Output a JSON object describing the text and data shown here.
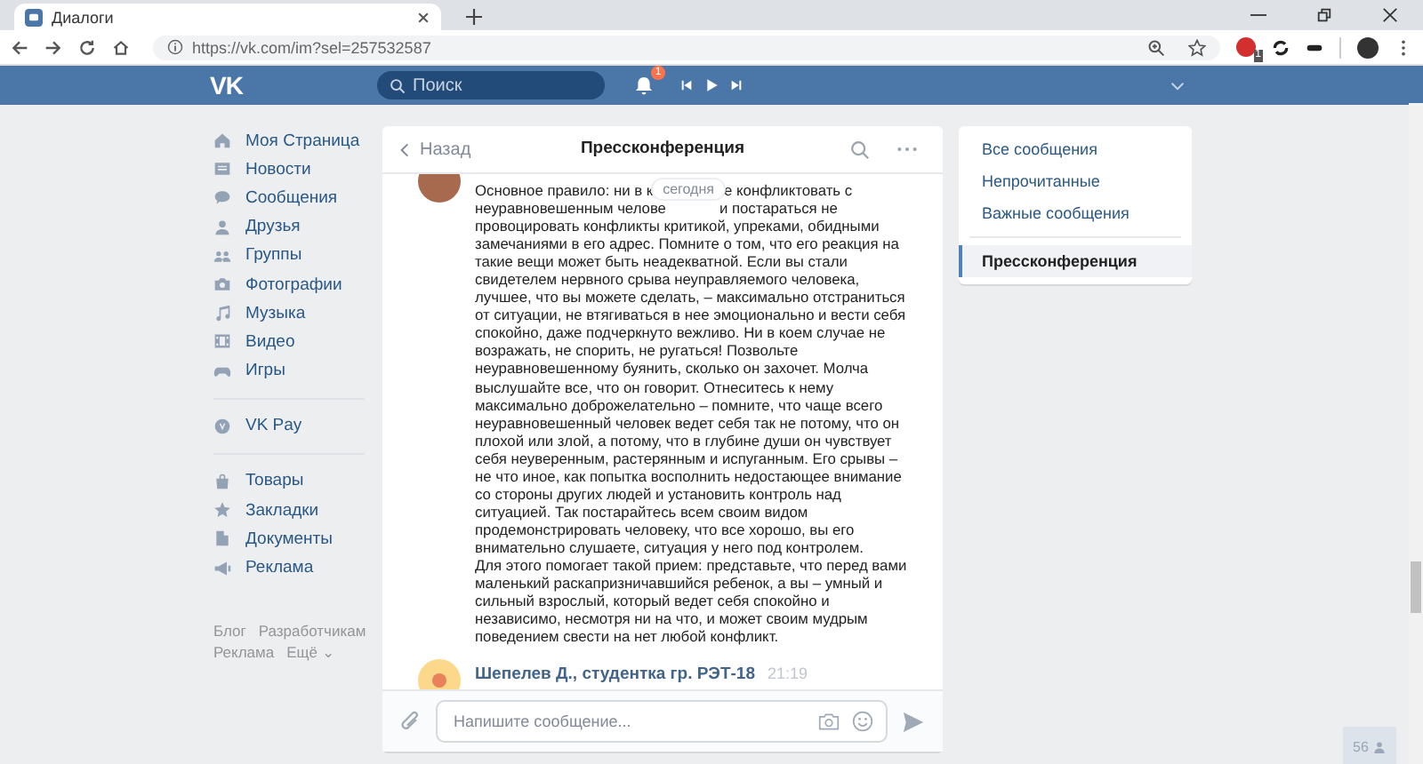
{
  "browser": {
    "tab": {
      "title": "Диалоги"
    },
    "url": "https://vk.com/im?sel=257532587",
    "extension_badge": "1"
  },
  "header": {
    "logo": "VK",
    "search": {
      "placeholder": "Поиск"
    },
    "notifications_badge": "1"
  },
  "sidebar": {
    "groups": [
      [
        {
          "label": "Моя Страница"
        },
        {
          "label": "Новости"
        },
        {
          "label": "Сообщения"
        },
        {
          "label": "Друзья"
        },
        {
          "label": "Группы"
        },
        {
          "label": "Фотографии"
        },
        {
          "label": "Музыка"
        },
        {
          "label": "Видео"
        },
        {
          "label": "Игры"
        }
      ],
      [
        {
          "label": "VK Pay"
        }
      ],
      [
        {
          "label": "Товары"
        },
        {
          "label": "Закладки"
        },
        {
          "label": "Документы"
        },
        {
          "label": "Реклама"
        }
      ]
    ],
    "footer_links": [
      "Блог",
      "Разработчикам",
      "Реклама",
      "Ещё ⌄"
    ]
  },
  "chat": {
    "back": "Назад",
    "title": "Прессконференция",
    "date_divider": "сегодня",
    "message": {
      "lines": [
        [
          "Основное правило: ни в к",
          "е конфликтовать с"
        ],
        [
          "неуравновешенным челове",
          "и постараться не"
        ],
        [
          "провоцировать конфликты критикой, упреками, обидными"
        ],
        [
          "замечаниями в его адрес. Помните о том, что его реакция на"
        ],
        [
          "такие вещи может быть неадекватной. Если вы стали"
        ],
        [
          "свидетелем нервного срыва неуправляемого человека,"
        ],
        [
          "лучшее, что вы можете сделать, – максимально отстраниться"
        ],
        [
          "от ситуации, не втягиваться в нее эмоционально и вести себя"
        ],
        [
          "спокойно, даже подчеркнуто вежливо. Ни в коем случае не"
        ],
        [
          "возражать, не спорить, не ругаться! Позвольте"
        ],
        [
          "неуравновешенному буянить, сколько он захочет. Молча"
        ],
        [
          "выслушайте все, что он говорит. Отнеситесь к нему"
        ],
        [
          "максимально доброжелательно – помните, что чаще всего"
        ],
        [
          "неуравновешенный человек ведет себя так не потому, что он"
        ],
        [
          "плохой или злой, а потому, что в глубине души он чувствует"
        ],
        [
          "себя неуверенным, растерянным и испуганным. Его срывы –"
        ],
        [
          "не что иное, как попытка восполнить недостающее внимание"
        ],
        [
          "со стороны других людей и установить контроль над"
        ],
        [
          "ситуацией. Так постарайтесь всем своим видом"
        ],
        [
          "продемонстрировать человеку, что все хорошо, вы его"
        ],
        [
          "внимательно слушаете, ситуация у него под контролем."
        ],
        [
          "Для этого помогает такой прием: представьте, что перед вами"
        ],
        [
          "маленький раскапризничавшийся ребенок, а вы – умный и"
        ],
        [
          "сильный взрослый, который ведет себя спокойно и"
        ],
        [
          "независимо, несмотря ни на что, и может своим мудрым"
        ],
        [
          "поведением свести на нет любой конфликт."
        ]
      ]
    },
    "next_message": {
      "author": "Шепелев Д., студентка гр. РЭТ-18",
      "time": "21:19"
    },
    "composer": {
      "placeholder": "Напишите сообщение..."
    }
  },
  "filters": [
    {
      "label": "Все сообщения",
      "selected": false
    },
    {
      "label": "Непрочитанные",
      "selected": false
    },
    {
      "label": "Важные сообщения",
      "selected": false
    }
  ],
  "conversations": [
    {
      "label": "Прессконференция",
      "selected": true
    }
  ],
  "online_badge": "56"
}
